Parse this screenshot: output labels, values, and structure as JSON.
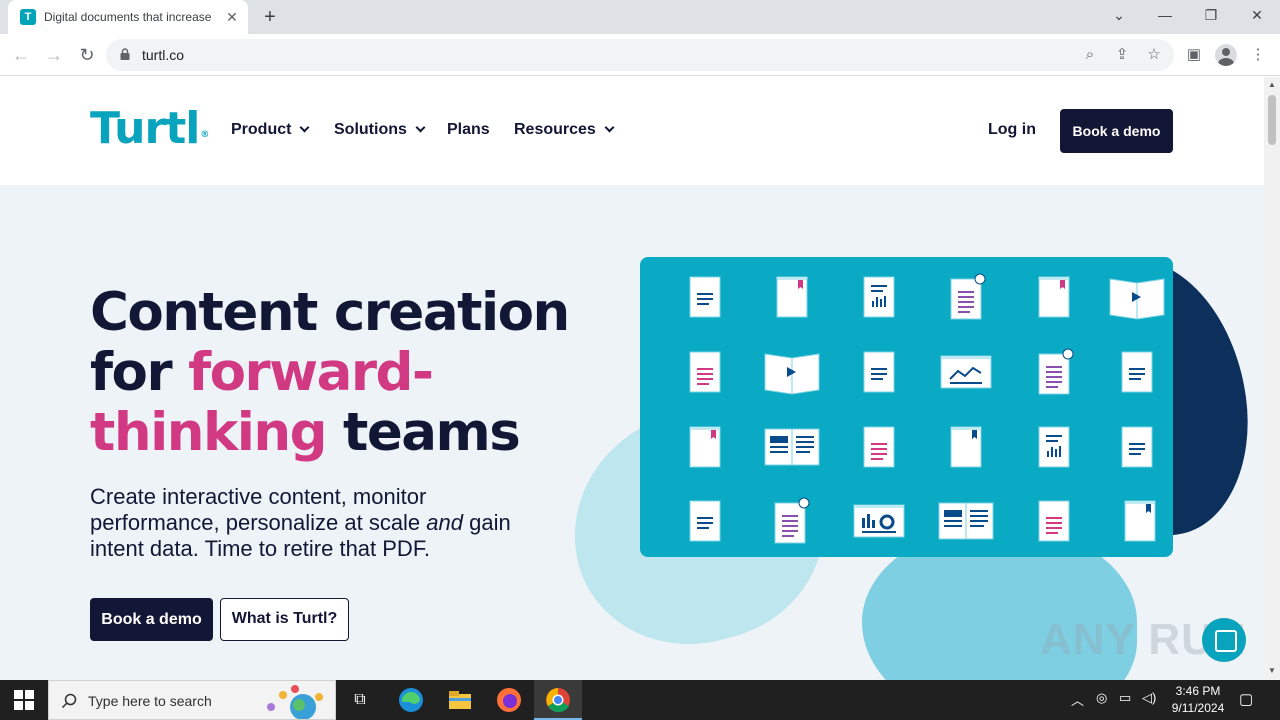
{
  "browser": {
    "tab_title": "Digital documents that increase",
    "tab_favicon_letter": "T",
    "url": "turtl.co"
  },
  "site": {
    "logo": "Turtl",
    "nav": [
      {
        "label": "Product",
        "dropdown": true
      },
      {
        "label": "Solutions",
        "dropdown": true
      },
      {
        "label": "Plans",
        "dropdown": false
      },
      {
        "label": "Resources",
        "dropdown": true
      }
    ],
    "login": "Log in",
    "header_cta": "Book a demo"
  },
  "hero": {
    "title_line1": "Content creation",
    "title_line2_pre": "for ",
    "title_line2_accent": "forward-",
    "title_line3_accent": "thinking",
    "title_line3_post": " teams",
    "subtitle_pre": "Create interactive content, monitor performance, personalize at scale ",
    "subtitle_em": "and",
    "subtitle_post": " gain intent data. Time to retire that PDF.",
    "primary_cta": "Book a demo",
    "secondary_cta": "What is Turtl?"
  },
  "watermark": "ANY RUN",
  "taskbar": {
    "search_placeholder": "Type here to search",
    "time": "3:46 PM",
    "date": "9/11/2024"
  },
  "colors": {
    "brand_teal": "#0aa3bd",
    "navy": "#131736",
    "accent_pink": "#d13a82"
  }
}
